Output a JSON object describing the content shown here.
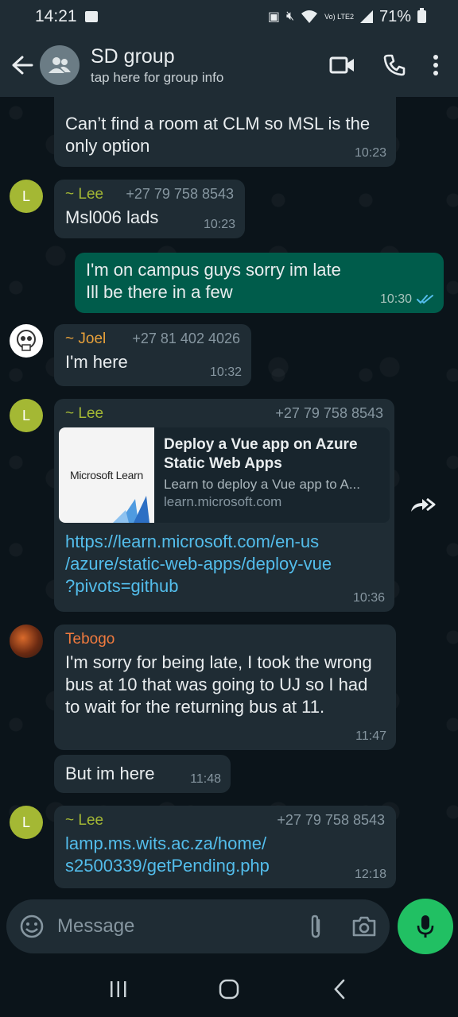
{
  "status": {
    "time": "14:21",
    "signal_text": "Vo) LTE2",
    "battery": "71%"
  },
  "header": {
    "title": "SD group",
    "subtitle": "tap here for group info"
  },
  "messages": [
    {
      "id": "m1",
      "direction": "in",
      "text": "Can’t find a room at CLM so MSL is the only option",
      "time": "10:23"
    },
    {
      "id": "m2",
      "direction": "in",
      "sender": "~ Lee",
      "phone": "+27 79 758 8543",
      "avatar": "L",
      "text": "Msl006 lads",
      "time": "10:23"
    },
    {
      "id": "m3",
      "direction": "out",
      "text_line1": "I'm on campus guys sorry im late",
      "text_line2": "Ill be there in a few",
      "time": "10:30"
    },
    {
      "id": "m4",
      "direction": "in",
      "sender": "~ Joel",
      "phone": "+27 81 402 4026",
      "text": "I'm here",
      "time": "10:32"
    },
    {
      "id": "m5",
      "direction": "in",
      "sender": "~ Lee",
      "phone": "+27 79 758 8543",
      "avatar": "L",
      "preview": {
        "thumb_text": "Microsoft Learn",
        "title": "Deploy a Vue app on Azure Static Web Apps",
        "desc": "Learn to deploy a Vue app to A...",
        "domain": "learn.microsoft.com"
      },
      "link_line1": "https://learn.microsoft.com/en-us",
      "link_line2": "/azure/static-web-apps/deploy-vue",
      "link_line3": "?pivots=github",
      "time": "10:36"
    },
    {
      "id": "m6",
      "direction": "in",
      "sender": "Tebogo",
      "text": "I'm sorry for being late, I took the wrong bus at 10 that was going to UJ so I had to wait for the returning bus at 11.",
      "time": "11:47"
    },
    {
      "id": "m7",
      "direction": "in",
      "text": "But  im here",
      "time": "11:48"
    },
    {
      "id": "m8",
      "direction": "in",
      "sender": "~ Lee",
      "phone": "+27 79 758 8543",
      "avatar": "L",
      "link_line1": "lamp.ms.wits.ac.za/home/",
      "link_line2": "s2500339/getPending.php",
      "time": "12:18"
    }
  ],
  "input": {
    "placeholder": "Message"
  },
  "colors": {
    "accent": "#21c063",
    "outgoing_bubble": "#005c4b",
    "incoming_bubble": "#1f2c34",
    "lee_name": "#a4b834",
    "joel_name": "#e8a13a",
    "tebogo_name": "#f07a3e",
    "link": "#53bdeb"
  }
}
